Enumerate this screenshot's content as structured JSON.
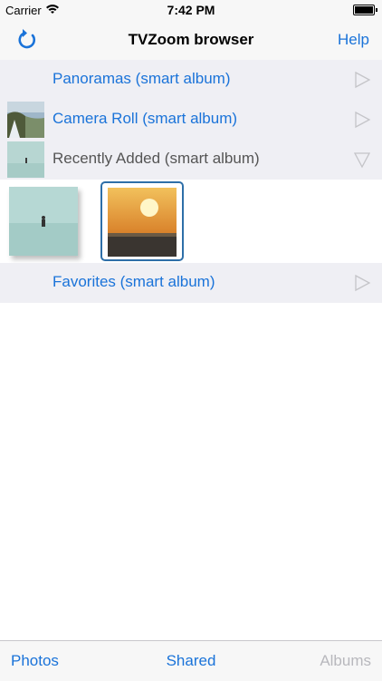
{
  "status": {
    "carrier": "Carrier",
    "time": "7:42 PM"
  },
  "nav": {
    "title": "TVZoom browser",
    "help": "Help"
  },
  "albums": [
    {
      "label": "Panoramas (smart album)",
      "state": "collapsed"
    },
    {
      "label": "Camera Roll (smart album)",
      "state": "collapsed"
    },
    {
      "label": "Recently Added (smart album)",
      "state": "expanded"
    },
    {
      "label": "Favorites (smart album)",
      "state": "collapsed"
    }
  ],
  "tabs": {
    "photos": "Photos",
    "shared": "Shared",
    "albums": "Albums"
  },
  "colors": {
    "accent": "#1a73d9",
    "inactive": "#b8b8bd",
    "row_bg": "#efeff4"
  }
}
